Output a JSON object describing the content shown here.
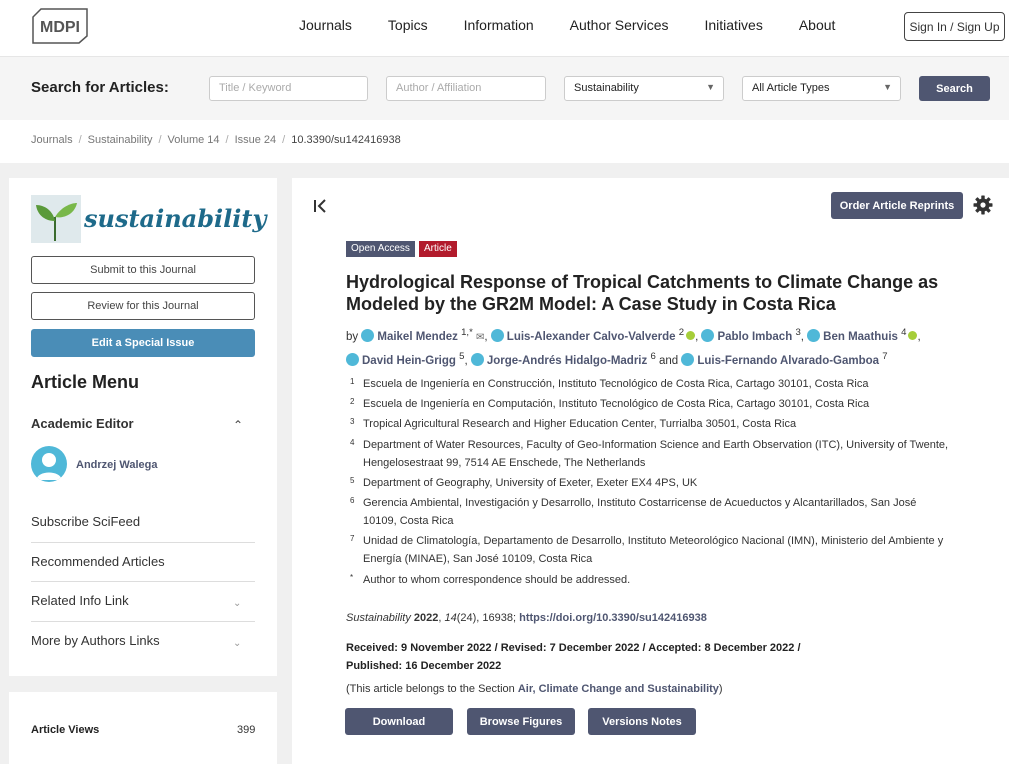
{
  "header": {
    "logo_text": "MDPI",
    "nav": [
      "Journals",
      "Topics",
      "Information",
      "Author Services",
      "Initiatives",
      "About"
    ],
    "signin_label": "Sign In / Sign Up"
  },
  "search": {
    "label": "Search for Articles:",
    "title_placeholder": "Title / Keyword",
    "author_placeholder": "Author / Affiliation",
    "journal_value": "Sustainability",
    "type_value": "All Article Types",
    "button_label": "Search"
  },
  "breadcrumb": [
    "Journals",
    "Sustainability",
    "Volume 14",
    "Issue 24",
    "10.3390/su142416938"
  ],
  "sidebar": {
    "journal_name": "sustainability",
    "submit_label": "Submit to this Journal",
    "review_label": "Review for this Journal",
    "special_label": "Edit a Special Issue",
    "menu_title": "Article Menu",
    "academic_editor_label": "Academic Editor",
    "editor_name": "Andrzej Walega",
    "items": [
      "Subscribe SciFeed",
      "Recommended Articles",
      "Related Info Link",
      "More by Authors Links"
    ],
    "views_label": "Article Views",
    "views_value": "399"
  },
  "article": {
    "reprints_label": "Order Article Reprints",
    "badge_open": "Open Access",
    "badge_type": "Article",
    "colors": {
      "open_badge": "#4f5671",
      "article_badge": "#b21b2c",
      "accent": "#4f5671"
    },
    "title": "Hydrological Response of Tropical Catchments to Climate Change as Modeled by the GR2M Model: A Case Study in Costa Rica",
    "by": "by",
    "authors": [
      {
        "name": "Maikel Mendez",
        "sup": "1,*"
      },
      {
        "name": "Luis-Alexander Calvo-Valverde",
        "sup": "2"
      },
      {
        "name": "Pablo Imbach",
        "sup": "3"
      },
      {
        "name": "Ben Maathuis",
        "sup": "4"
      },
      {
        "name": "David Hein-Grigg",
        "sup": "5"
      },
      {
        "name": "Jorge-Andrés Hidalgo-Madriz",
        "sup": "6"
      },
      {
        "name": "Luis-Fernando Alvarado-Gamboa",
        "sup": "7"
      }
    ],
    "and_word": "and",
    "affiliations": [
      {
        "n": "1",
        "text": "Escuela de Ingeniería en Construcción, Instituto Tecnológico de Costa Rica, Cartago 30101, Costa Rica"
      },
      {
        "n": "2",
        "text": "Escuela de Ingeniería en Computación, Instituto Tecnológico de Costa Rica, Cartago 30101, Costa Rica"
      },
      {
        "n": "3",
        "text": "Tropical Agricultural Research and Higher Education Center, Turrialba 30501, Costa Rica"
      },
      {
        "n": "4",
        "text": "Department of Water Resources, Faculty of Geo-Information Science and Earth Observation (ITC), University of Twente, Hengelosestraat 99, 7514 AE Enschede, The Netherlands"
      },
      {
        "n": "5",
        "text": "Department of Geography, University of Exeter, Exeter EX4 4PS, UK"
      },
      {
        "n": "6",
        "text": "Gerencia Ambiental, Investigación y Desarrollo, Instituto Costarricense de Acueductos y Alcantarillados, San José 10109, Costa Rica"
      },
      {
        "n": "7",
        "text": "Unidad de Climatología, Departamento de Desarrollo, Instituto Meteorológico Nacional (IMN), Ministerio del Ambiente y Energía (MINAE), San José 10109, Costa Rica"
      },
      {
        "n": "*",
        "text": "Author to whom correspondence should be addressed."
      }
    ],
    "citation": {
      "journal": "Sustainability",
      "year": "2022",
      "rest": ", 14(24), 16938;",
      "volume": "14",
      "issue_pages": "(24), 16938;",
      "doi": "https://doi.org/10.3390/su142416938"
    },
    "dates": "Received: 9 November 2022 / Revised: 7 December 2022 / Accepted: 8 December 2022 / Published: 16 December 2022",
    "section_prefix": "(This article belongs to the Section ",
    "section_name": "Air, Climate Change and Sustainability",
    "section_suffix": ")",
    "buttons": [
      "Download",
      "Browse Figures",
      "Versions Notes"
    ]
  }
}
